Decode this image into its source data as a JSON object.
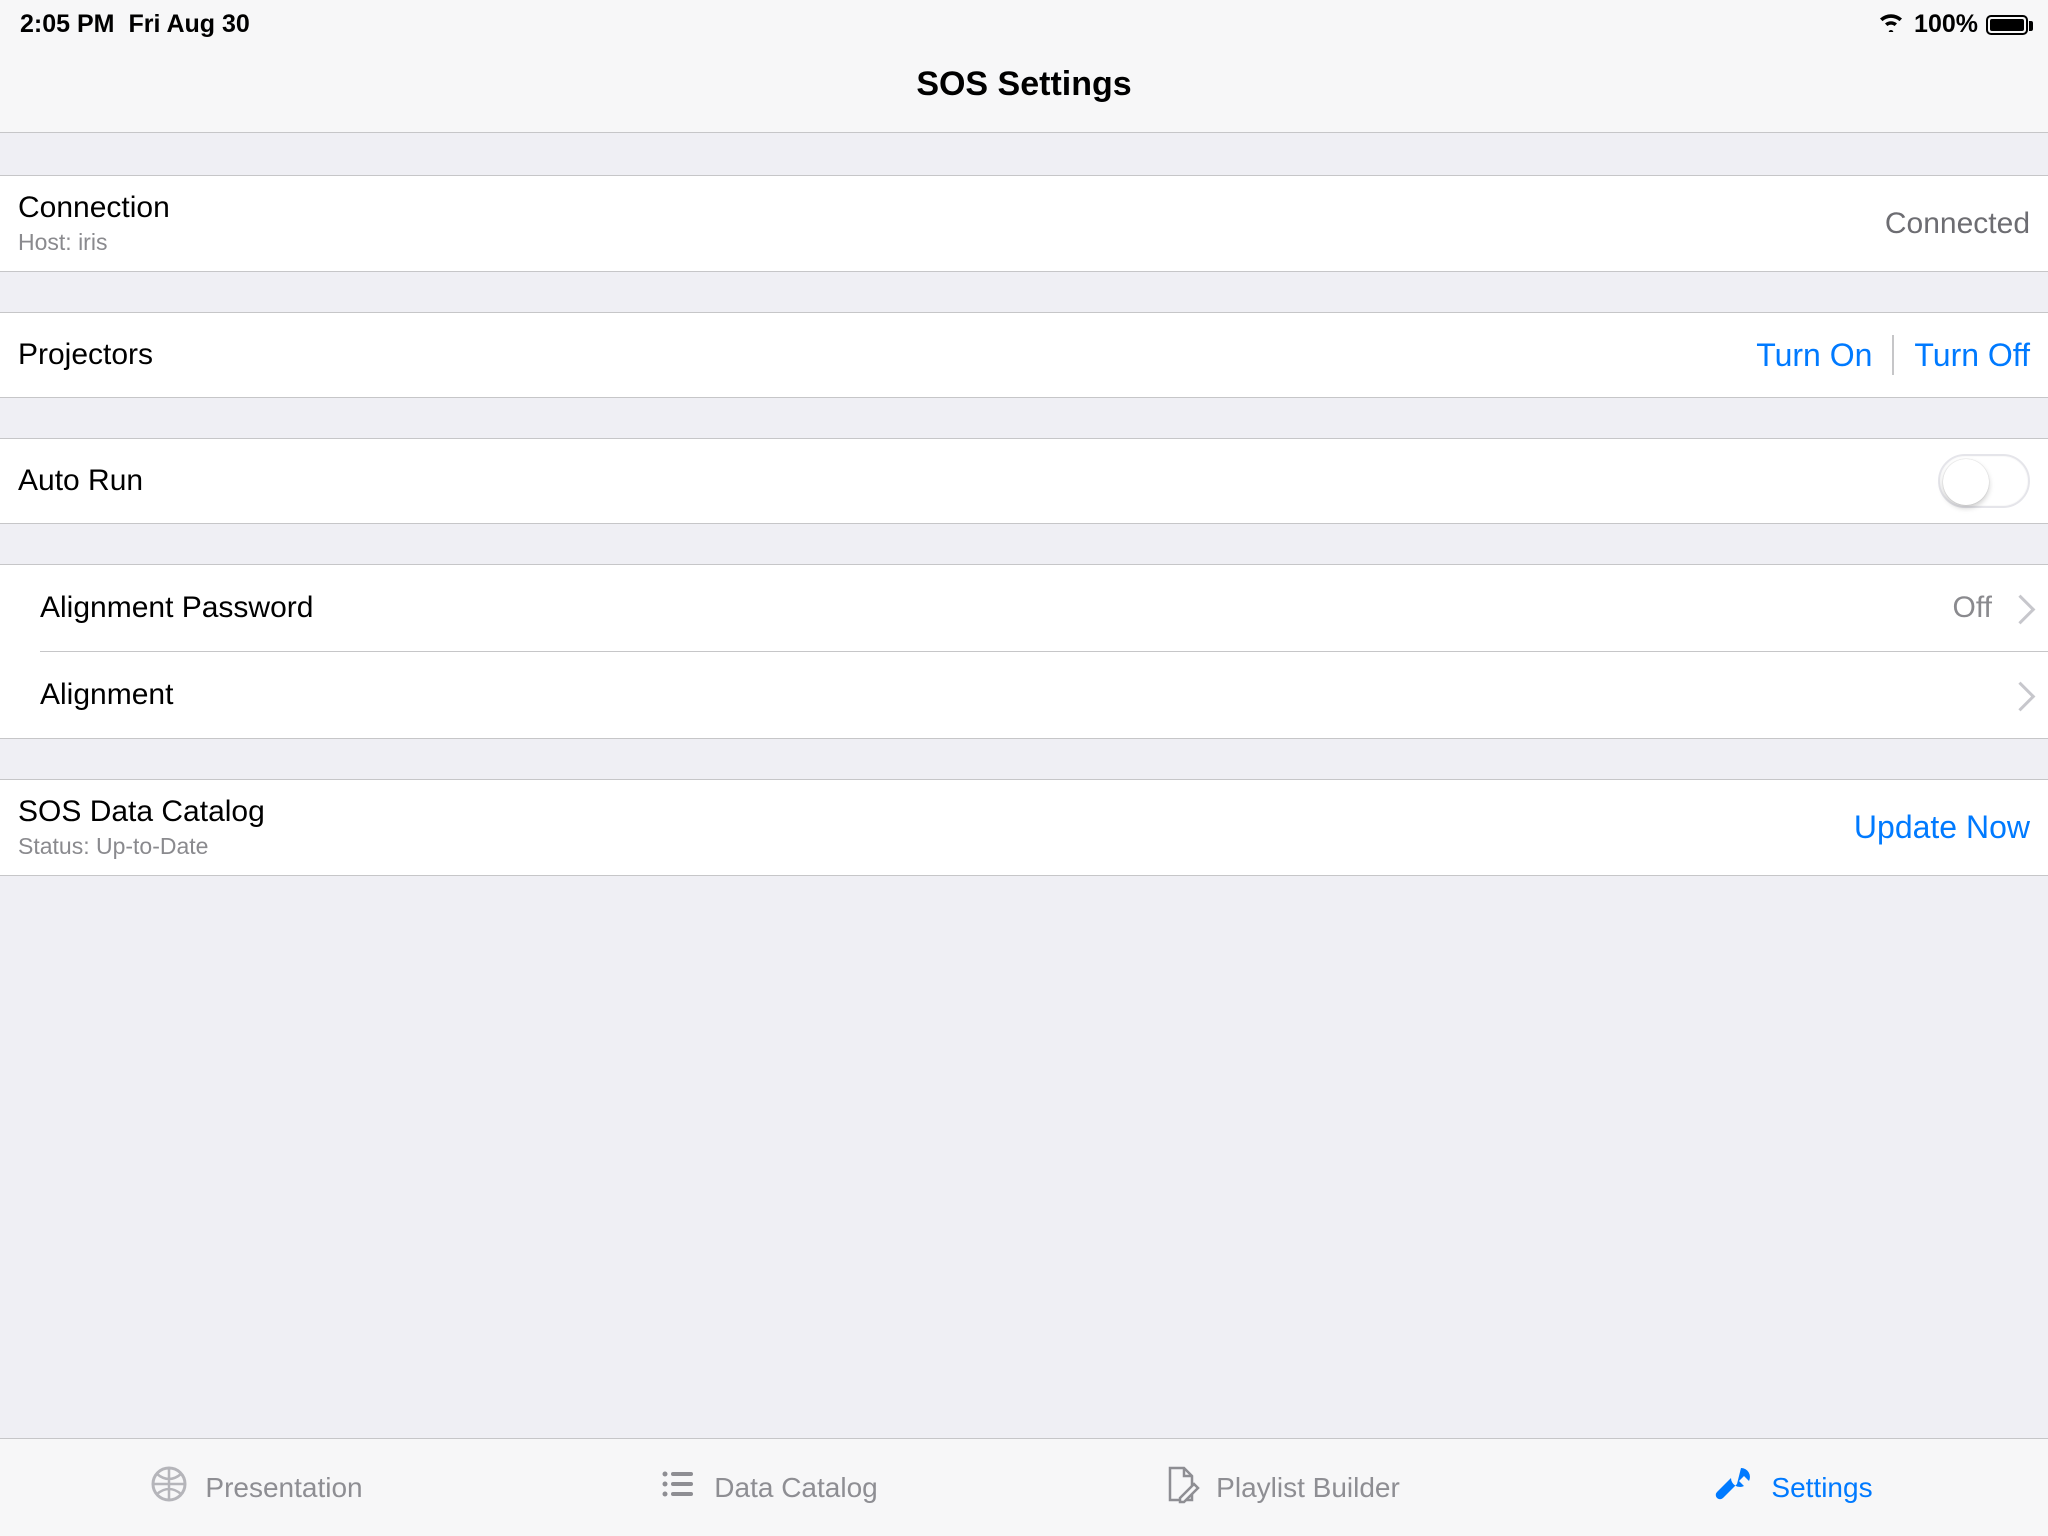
{
  "statusBar": {
    "time": "2:05 PM",
    "date": "Fri Aug 30",
    "batteryPercent": "100%"
  },
  "header": {
    "title": "SOS Settings"
  },
  "connection": {
    "title": "Connection",
    "subtitle": "Host: iris",
    "status": "Connected"
  },
  "projectors": {
    "title": "Projectors",
    "turnOnLabel": "Turn On",
    "turnOffLabel": "Turn Off"
  },
  "autoRun": {
    "title": "Auto Run",
    "value": false
  },
  "alignmentPassword": {
    "title": "Alignment Password",
    "value": "Off"
  },
  "alignment": {
    "title": "Alignment"
  },
  "dataCatalog": {
    "title": "SOS Data Catalog",
    "subtitle": "Status: Up-to-Date",
    "actionLabel": "Update Now"
  },
  "tabs": {
    "presentation": "Presentation",
    "dataCatalog": "Data Catalog",
    "playlistBuilder": "Playlist Builder",
    "settings": "Settings"
  }
}
